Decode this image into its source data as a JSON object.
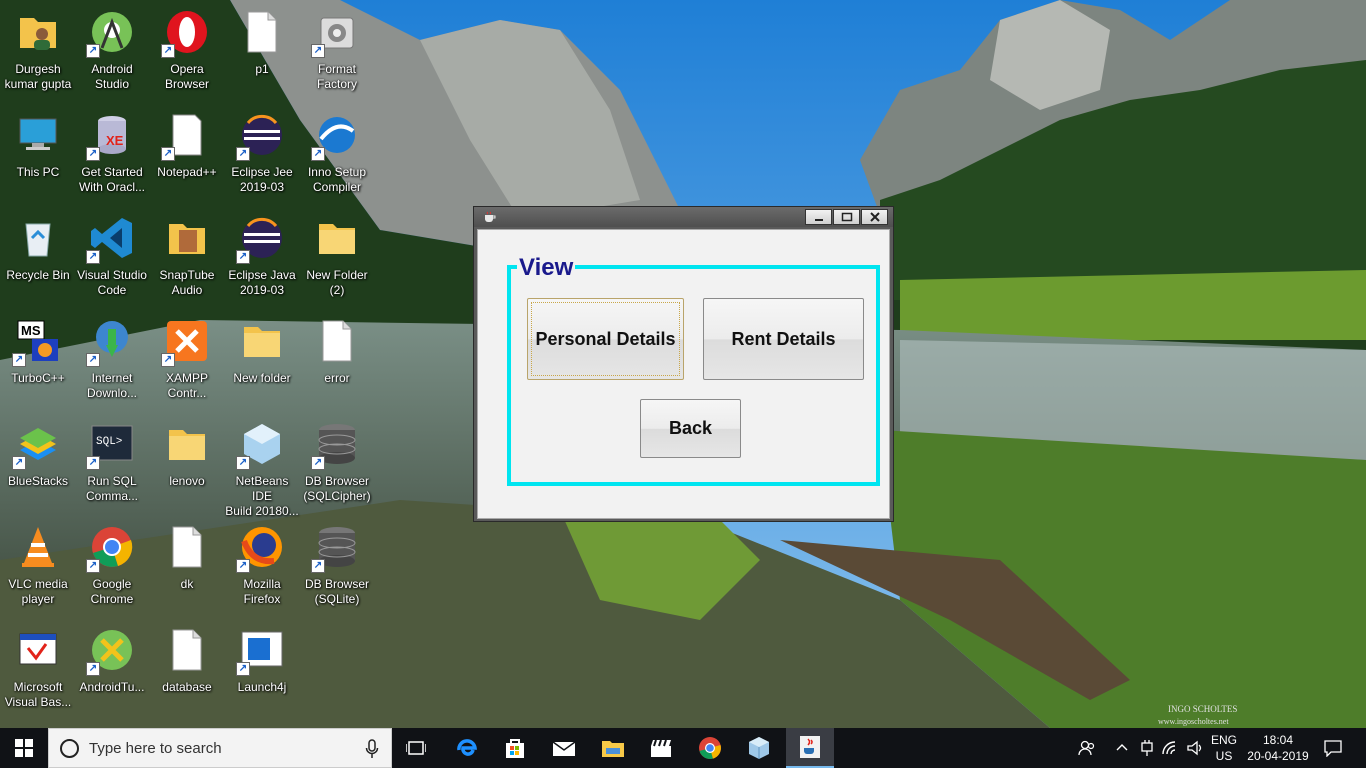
{
  "desktop": {
    "icons": [
      {
        "label": "Durgesh\nkumar gupta",
        "icon": "user-folder-icon"
      },
      {
        "label": "Android\nStudio",
        "icon": "android-studio-icon"
      },
      {
        "label": "Opera\nBrowser",
        "icon": "opera-icon"
      },
      {
        "label": "p1",
        "icon": "file-icon"
      },
      {
        "label": "Format\nFactory",
        "icon": "format-factory-icon"
      },
      {
        "label": "This PC",
        "icon": "this-pc-icon"
      },
      {
        "label": "Get Started\nWith Oracl...",
        "icon": "oracle-db-icon"
      },
      {
        "label": "Notepad++",
        "icon": "notepadpp-icon"
      },
      {
        "label": "Eclipse Jee\n2019-03",
        "icon": "eclipse-icon"
      },
      {
        "label": "Inno Setup\nCompiler",
        "icon": "inno-setup-icon"
      },
      {
        "label": "Recycle Bin",
        "icon": "recycle-bin-icon"
      },
      {
        "label": "Visual Studio\nCode",
        "icon": "vscode-icon"
      },
      {
        "label": "SnapTube\nAudio",
        "icon": "snaptube-folder-icon"
      },
      {
        "label": "Eclipse Java\n2019-03",
        "icon": "eclipse-icon"
      },
      {
        "label": "New Folder\n(2)",
        "icon": "folder-icon"
      },
      {
        "label": "TurboC++",
        "icon": "turboc-icon"
      },
      {
        "label": "Internet\nDownlo...",
        "icon": "idm-icon"
      },
      {
        "label": "XAMPP\nContr...",
        "icon": "xampp-icon"
      },
      {
        "label": "New folder",
        "icon": "folder-icon"
      },
      {
        "label": "error",
        "icon": "file-icon"
      },
      {
        "label": "BlueStacks",
        "icon": "bluestacks-icon"
      },
      {
        "label": "Run SQL\nComma...",
        "icon": "sql-cmd-icon"
      },
      {
        "label": "lenovo",
        "icon": "folder-icon"
      },
      {
        "label": "NetBeans IDE\nBuild 20180...",
        "icon": "netbeans-icon"
      },
      {
        "label": "DB Browser\n(SQLCipher)",
        "icon": "db-browser-icon"
      },
      {
        "label": "VLC media\nplayer",
        "icon": "vlc-icon"
      },
      {
        "label": "Google\nChrome",
        "icon": "chrome-icon"
      },
      {
        "label": "dk",
        "icon": "file-icon"
      },
      {
        "label": "Mozilla\nFirefox",
        "icon": "firefox-icon"
      },
      {
        "label": "DB Browser\n(SQLite)",
        "icon": "db-browser-icon"
      },
      {
        "label": "Microsoft\nVisual Bas...",
        "icon": "vb-icon"
      },
      {
        "label": "AndroidTu...",
        "icon": "android-tool-icon"
      },
      {
        "label": "database",
        "icon": "file-icon"
      },
      {
        "label": "Launch4j",
        "icon": "launch4j-icon"
      }
    ]
  },
  "window": {
    "group_title": "View",
    "personal_label": "Personal Details",
    "rent_label": "Rent Details",
    "back_label": "Back"
  },
  "taskbar": {
    "search_placeholder": "Type here to search",
    "lang_top": "ENG",
    "lang_bottom": "US",
    "time": "18:04",
    "date": "20-04-2019"
  },
  "colors": {
    "group_border": "#00e5f0",
    "group_title": "#1a1a8c",
    "taskbar": "#101216"
  }
}
